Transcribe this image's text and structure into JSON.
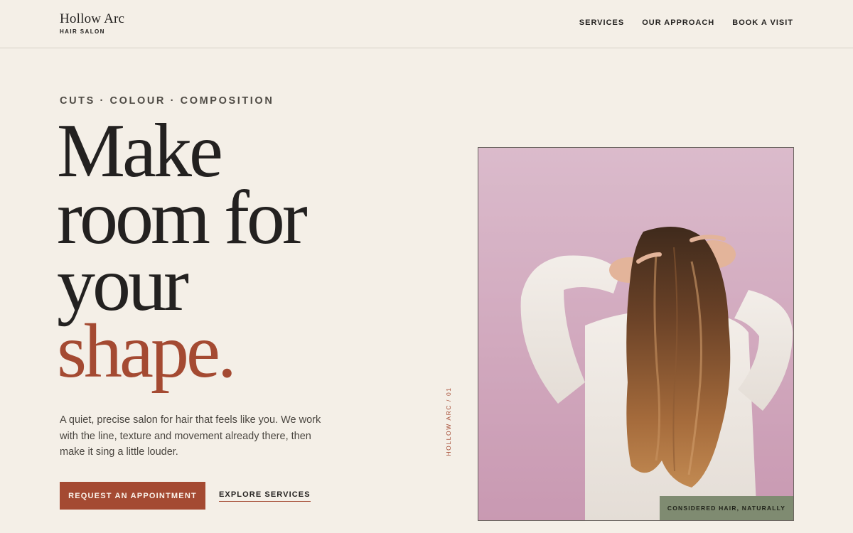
{
  "header": {
    "brand_name": "Hollow Arc",
    "brand_sub": "HAIR SALON",
    "nav": [
      "SERVICES",
      "OUR APPROACH",
      "BOOK A VISIT"
    ]
  },
  "hero": {
    "eyebrow": "CUTS · COLOUR · COMPOSITION",
    "headline": [
      "Make",
      "room for",
      "your",
      "shape."
    ],
    "lede": "A quiet, precise salon for hair that feels like you. We work with the line, texture and movement already there, then make it sing a little louder.",
    "cta_primary": "REQUEST AN APPOINTMENT",
    "cta_secondary": "EXPLORE SERVICES"
  },
  "vertical_caption": "HOLLOW ARC / 01",
  "photo": {
    "badge": "CONSIDERED HAIR, NATURALLY",
    "icon": "woman-with-long-hair-photo"
  },
  "colors": {
    "background": "#f4efe7",
    "accent": "#a44a32",
    "text": "#242220",
    "badge": "#7f8b71",
    "photo_wall": "#cfa3ba"
  }
}
